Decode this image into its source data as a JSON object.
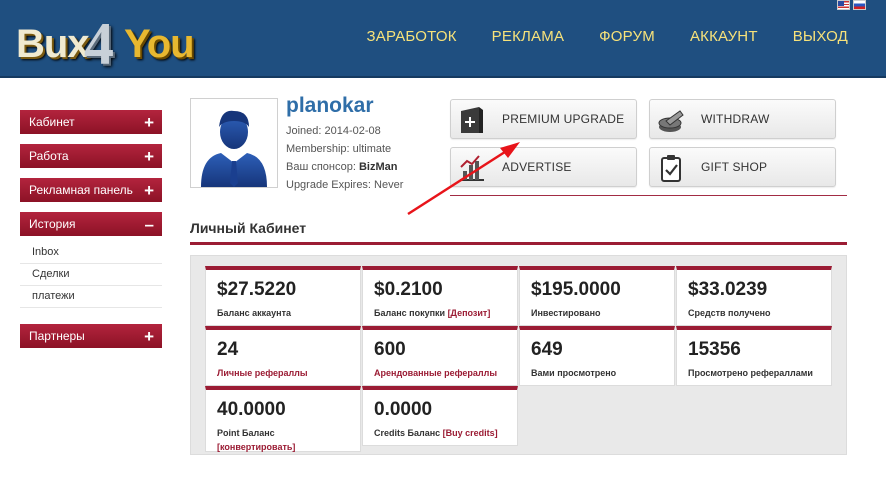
{
  "logo": {
    "part1": "Bux",
    "part2": "4",
    "part3": "You"
  },
  "nav": [
    "ЗАРАБОТОК",
    "РЕКЛАМА",
    "ФОРУМ",
    "АККАУНТ",
    "ВЫХОД"
  ],
  "flags": [
    "us-flag",
    "ru-flag"
  ],
  "sidebar": {
    "items": [
      {
        "label": "Кабинет",
        "sign": "+"
      },
      {
        "label": "Работа",
        "sign": "+"
      },
      {
        "label": "Рекламная панель",
        "sign": "+"
      },
      {
        "label": "История",
        "sign": "–"
      }
    ],
    "history_sub": [
      "Inbox",
      "Сделки",
      "платежи"
    ],
    "partners": {
      "label": "Партнеры",
      "sign": "+"
    }
  },
  "profile": {
    "username": "planokar",
    "joined": "Joined: 2014-02-08",
    "membership": "Membership: ultimate",
    "sponsor_label": "Ваш спонсор: ",
    "sponsor": "BizMan",
    "upgrade": "Upgrade Expires: Never"
  },
  "tiles": [
    {
      "label": "PREMIUM UPGRADE",
      "icon": "plus-icon"
    },
    {
      "label": "WITHDRAW",
      "icon": "coins-icon"
    },
    {
      "label": "ADVERTISE",
      "icon": "chart-icon"
    },
    {
      "label": "GIFT SHOP",
      "icon": "clipboard-icon"
    }
  ],
  "section_title": "Личный Кабинет",
  "cards": [
    {
      "value": "$27.5220",
      "label": "Баланс аккаунта",
      "link": ""
    },
    {
      "value": "$0.2100",
      "label": "Баланс покупки ",
      "link": "[Депозит]"
    },
    {
      "value": "$195.0000",
      "label": "Инвестировано",
      "link": ""
    },
    {
      "value": "$33.0239",
      "label": "Средств получено",
      "link": ""
    },
    {
      "value": "24",
      "label": "Личные рефераллы",
      "link": ""
    },
    {
      "value": "600",
      "label": "Арендованные рефераллы",
      "link": ""
    },
    {
      "value": "649",
      "label": "Вами просмотрено",
      "link": ""
    },
    {
      "value": "15356",
      "label": "Просмотрено рефераллами",
      "link": ""
    },
    {
      "value": "40.0000",
      "label": "Point Баланс",
      "link": "[конвертировать]"
    },
    {
      "value": "0.0000",
      "label": "Credits Баланс ",
      "link": "[Buy credits]"
    }
  ],
  "colors": {
    "header": "#1f4f80",
    "nav_text": "#f7e27a",
    "accent": "#9b1c34",
    "username": "#2f6ea8"
  }
}
